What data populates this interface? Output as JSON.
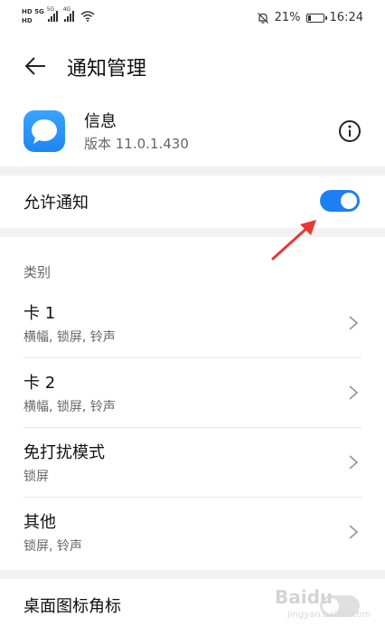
{
  "status_bar": {
    "hd1": "HD 5G",
    "hd2": "HD",
    "sig1": "5G",
    "sig2": "4G",
    "battery_percent": "21%",
    "battery_level": 0.21,
    "time": "16:24",
    "icons": [
      "wifi-icon",
      "mute-bell-icon",
      "battery-icon"
    ]
  },
  "header": {
    "title": "通知管理",
    "back_icon": "arrow-left-icon"
  },
  "app": {
    "name": "信息",
    "version": "版本 11.0.1.430",
    "icon": "message-bubble-icon",
    "info_icon": "info-circle-icon"
  },
  "allow": {
    "label": "允许通知",
    "enabled": true
  },
  "categories": {
    "label": "类别",
    "items": [
      {
        "title": "卡 1",
        "sub": "横幅, 锁屏, 铃声"
      },
      {
        "title": "卡 2",
        "sub": "横幅, 锁屏, 铃声"
      },
      {
        "title": "免打扰模式",
        "sub": "锁屏"
      },
      {
        "title": "其他",
        "sub": "锁屏, 铃声"
      }
    ]
  },
  "badge": {
    "label": "桌面图标角标",
    "enabled": false
  },
  "watermark": {
    "logo": "Baidu",
    "sub": "jingyan.baidu.com"
  },
  "colors": {
    "accent": "#1e7ff0",
    "arrow": "#e53935",
    "band": "#f2f2f2"
  }
}
